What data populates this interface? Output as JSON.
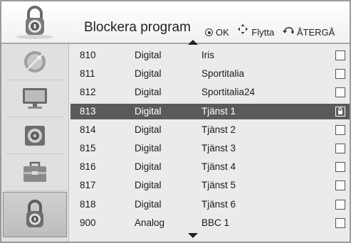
{
  "header": {
    "title": "Blockera program",
    "legend": {
      "ok": "OK",
      "move": "Flytta",
      "back": "ÅTERGÅ"
    }
  },
  "sidebar": {
    "items": [
      {
        "icon": "satellite-dish-icon",
        "active": false
      },
      {
        "icon": "tv-screen-icon",
        "active": false
      },
      {
        "icon": "speaker-icon",
        "active": false
      },
      {
        "icon": "toolbox-icon",
        "active": false
      },
      {
        "icon": "lock-icon",
        "active": true
      }
    ]
  },
  "channels": [
    {
      "number": "810",
      "type": "Digital",
      "name": "Iris",
      "locked": false,
      "selected": false
    },
    {
      "number": "811",
      "type": "Digital",
      "name": "Sportitalia",
      "locked": false,
      "selected": false
    },
    {
      "number": "812",
      "type": "Digital",
      "name": "Sportitalia24",
      "locked": false,
      "selected": false
    },
    {
      "number": "813",
      "type": "Digital",
      "name": "Tjänst 1",
      "locked": true,
      "selected": true
    },
    {
      "number": "814",
      "type": "Digital",
      "name": "Tjänst 2",
      "locked": false,
      "selected": false
    },
    {
      "number": "815",
      "type": "Digital",
      "name": "Tjänst 3",
      "locked": false,
      "selected": false
    },
    {
      "number": "816",
      "type": "Digital",
      "name": "Tjänst 4",
      "locked": false,
      "selected": false
    },
    {
      "number": "817",
      "type": "Digital",
      "name": "Tjänst 5",
      "locked": false,
      "selected": false
    },
    {
      "number": "818",
      "type": "Digital",
      "name": "Tjänst 6",
      "locked": false,
      "selected": false
    },
    {
      "number": "900",
      "type": "Analog",
      "name": "BBC 1",
      "locked": false,
      "selected": false
    }
  ]
}
